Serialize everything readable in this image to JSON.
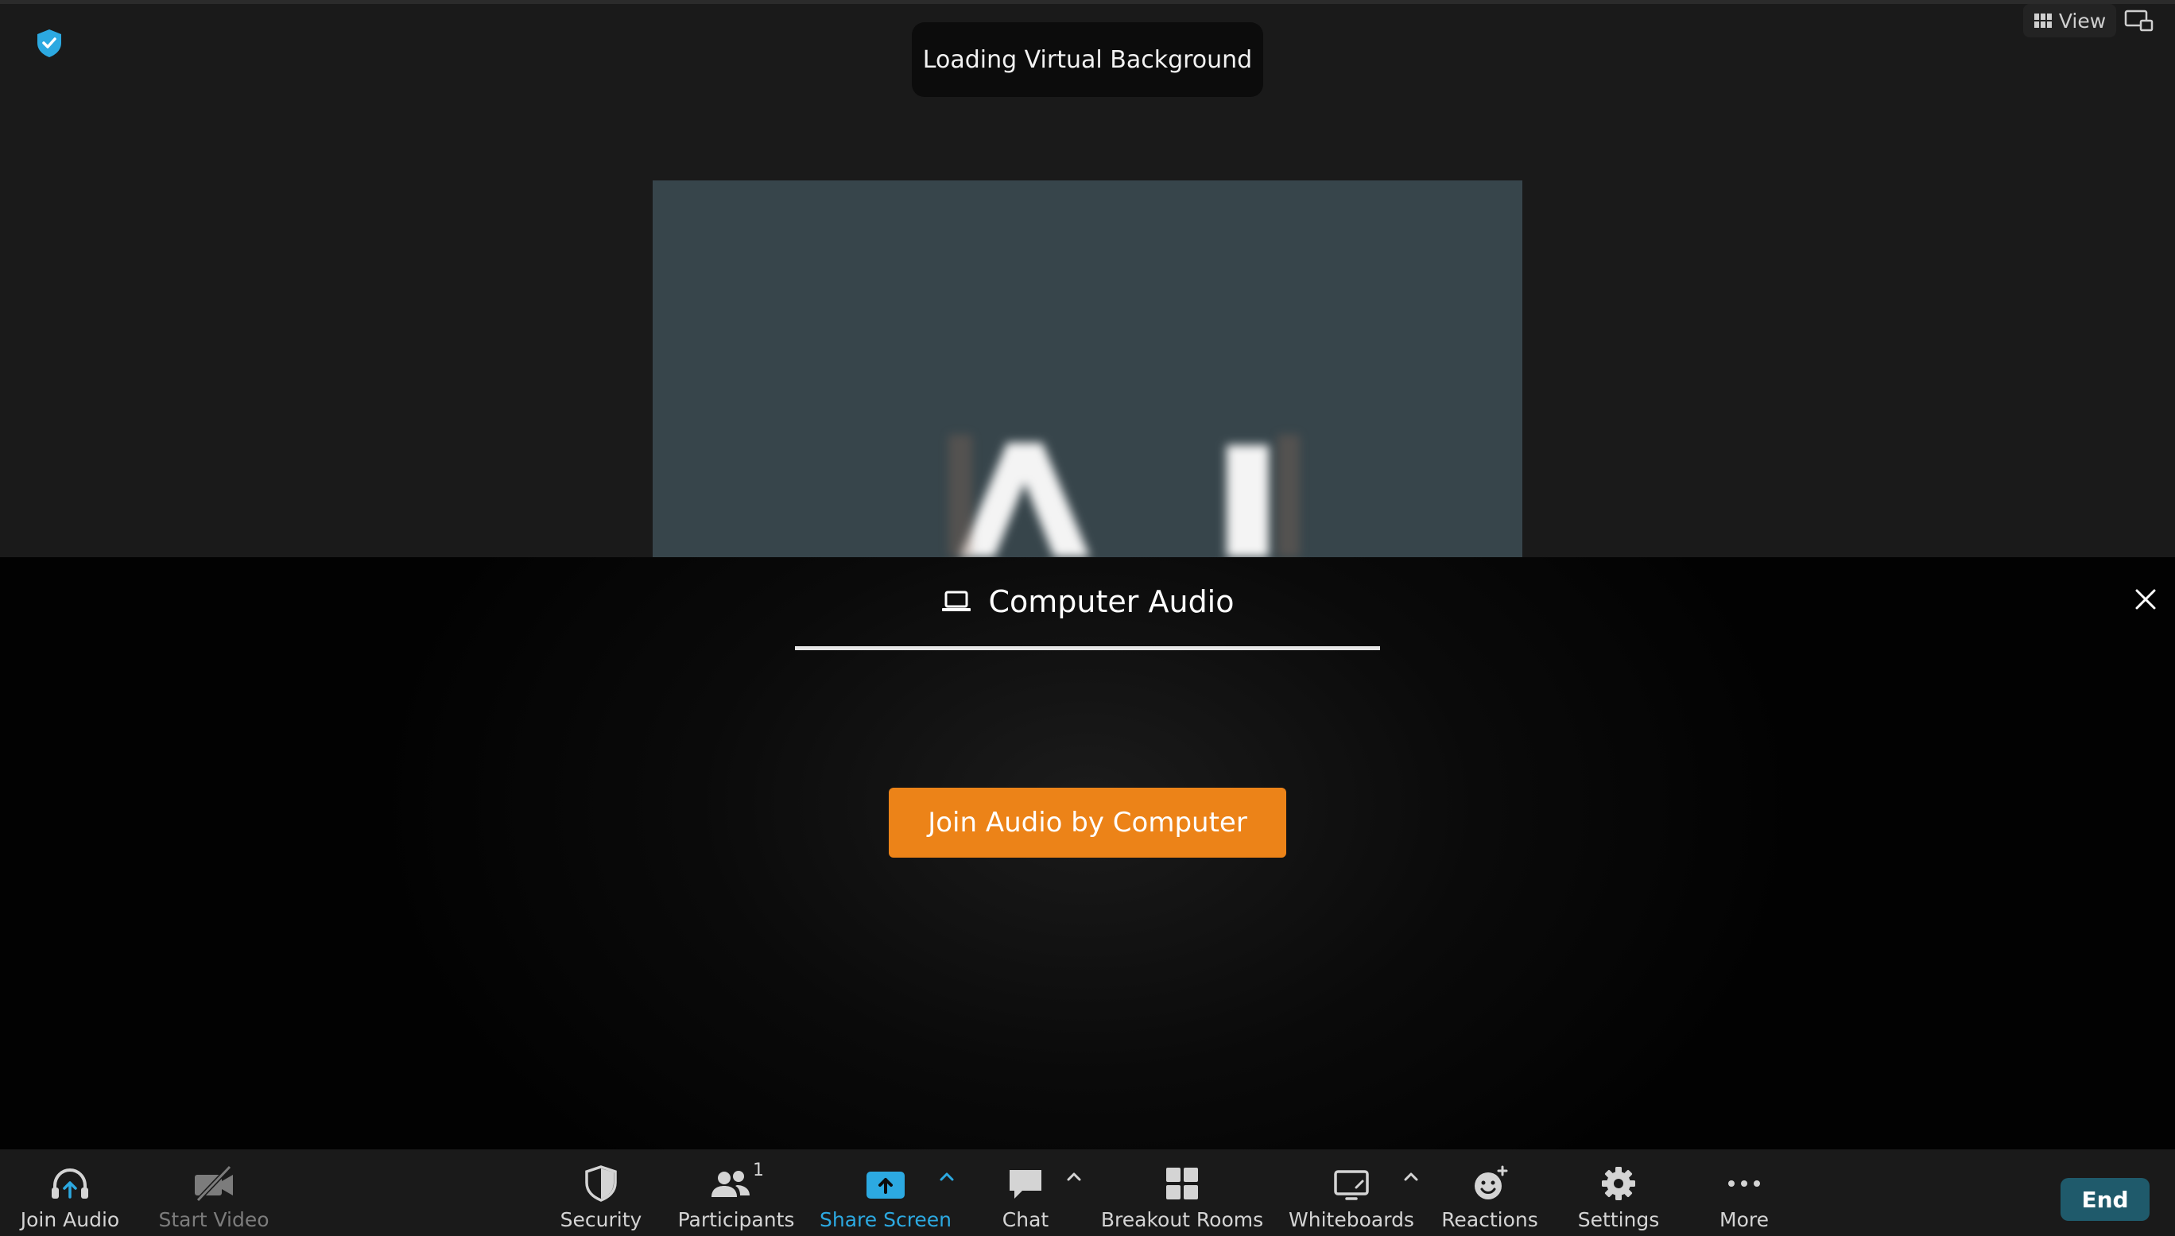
{
  "colors": {
    "accent": "#2ca9e1",
    "join_button": "#ec8318",
    "end_button": "#1f5a6b",
    "shield": "#2ca9e1"
  },
  "top": {
    "security_indicator_icon": "shield-check-icon",
    "toast": "Loading Virtual Background",
    "view_label": "View",
    "view_icon": "grid-view-icon",
    "fullscreen_icon": "fullscreen-icon"
  },
  "audio_panel": {
    "tab_label": "Computer Audio",
    "tab_icon": "laptop-icon",
    "close_icon": "close-icon",
    "join_button": "Join Audio by Computer"
  },
  "toolbar": {
    "join_audio": "Join Audio",
    "start_video": "Start Video",
    "security": "Security",
    "participants": "Participants",
    "participants_count": "1",
    "share_screen": "Share Screen",
    "chat": "Chat",
    "breakout_rooms": "Breakout Rooms",
    "whiteboards": "Whiteboards",
    "reactions": "Reactions",
    "settings": "Settings",
    "more": "More",
    "end": "End"
  }
}
